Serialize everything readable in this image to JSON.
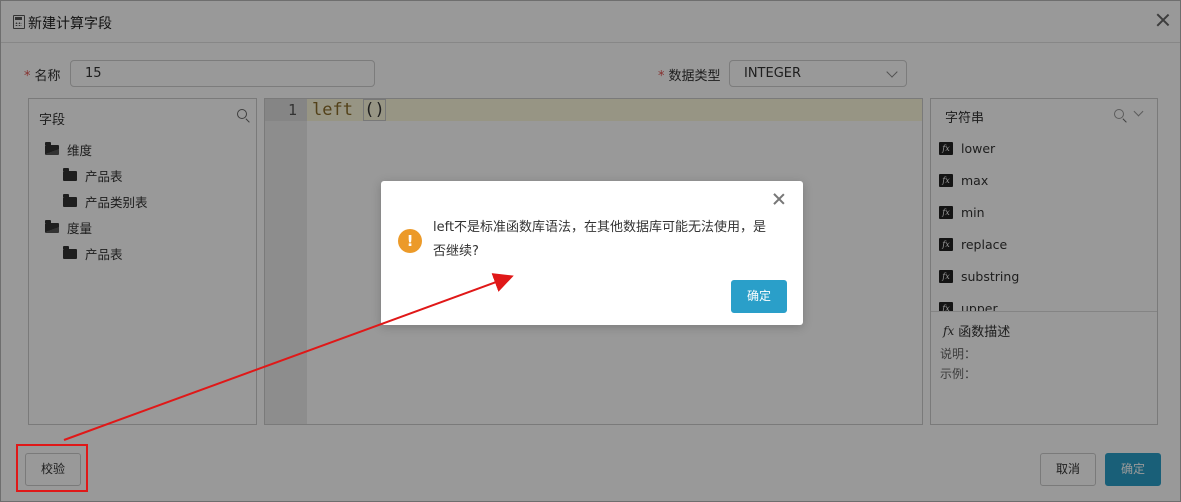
{
  "window": {
    "title": "新建计算字段"
  },
  "form": {
    "name_label": "名称",
    "name_value": "15",
    "datatype_label": "数据类型",
    "datatype_value": "INTEGER"
  },
  "fields_panel": {
    "header": "字段",
    "groups": [
      {
        "label": "维度",
        "children": [
          "产品表",
          "产品类别表"
        ]
      },
      {
        "label": "度量",
        "children": [
          "产品表"
        ]
      }
    ]
  },
  "editor": {
    "line_number": "1",
    "code_keyword": "left",
    "code_paren": "()"
  },
  "functions_panel": {
    "category": "字符串",
    "items": [
      "lower",
      "max",
      "min",
      "replace",
      "substring",
      "upper"
    ],
    "desc_title": "函数描述",
    "desc_explain_label": "说明：",
    "desc_example_label": "示例："
  },
  "footer": {
    "validate_label": "校验",
    "cancel_label": "取消",
    "ok_label": "确定"
  },
  "modal": {
    "message": "left不是标准函数库语法，在其他数据库可能无法使用，是否继续?",
    "ok_label": "确定"
  },
  "colors": {
    "primary": "#2a9fc9",
    "warning": "#ec9a29",
    "annotation": "#e01818"
  }
}
